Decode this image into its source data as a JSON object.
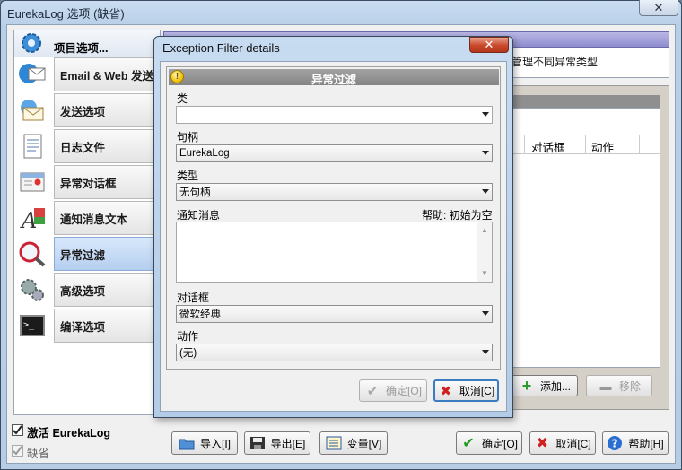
{
  "window": {
    "title": "EurekaLog 选项 (缺省)",
    "close_glyph": "✕"
  },
  "nav": {
    "header": "项目选项...",
    "items": [
      {
        "label": "Email & Web 发送",
        "icon": "email-web-send-icon"
      },
      {
        "label": "发送选项",
        "icon": "send-options-icon"
      },
      {
        "label": "日志文件",
        "icon": "log-file-icon"
      },
      {
        "label": "异常对话框",
        "icon": "exception-dialog-icon"
      },
      {
        "label": "通知消息文本",
        "icon": "message-text-icon"
      },
      {
        "label": "异常过滤",
        "icon": "exception-filter-icon",
        "selected": true
      },
      {
        "label": "高级选项",
        "icon": "advanced-options-icon"
      },
      {
        "label": "编译选项",
        "icon": "compile-options-icon"
      }
    ]
  },
  "panel": {
    "description_tail": "管理不同异常类型.",
    "list_columns": [
      "对话框",
      "动作"
    ],
    "add_label": "添加...",
    "remove_label": "移除"
  },
  "footer": {
    "activate_label": "激活 EurekaLog",
    "activate_checked": true,
    "default_label": "缺省",
    "default_checked": true,
    "import_label": "导入[I]",
    "export_label": "导出[E]",
    "vars_label": "变量[V]",
    "ok_label": "确定[O]",
    "cancel_label": "取消[C]",
    "help_label": "帮助[H]"
  },
  "dialog": {
    "title": "Exception Filter details",
    "close_glyph": "✕",
    "group_title": "异常过滤",
    "class_label": "类",
    "class_value": "",
    "handler_label": "句柄",
    "handler_value": "EurekaLog",
    "type_label": "类型",
    "type_value": "无句柄",
    "message_label": "通知消息",
    "message_help": "帮助: 初始为空",
    "message_value": "",
    "dialog_label": "对话框",
    "dialog_value": "微软经典",
    "action_label": "动作",
    "action_value": "(无)",
    "ok_label": "确定[O]",
    "cancel_label": "取消[C]"
  },
  "colors": {
    "title_bar": "#c9dcf0",
    "selected_nav": "#b5cff0",
    "dialog_close": "#c9472a",
    "group_header": "#858585",
    "panel_header": "#8f8cd0"
  }
}
